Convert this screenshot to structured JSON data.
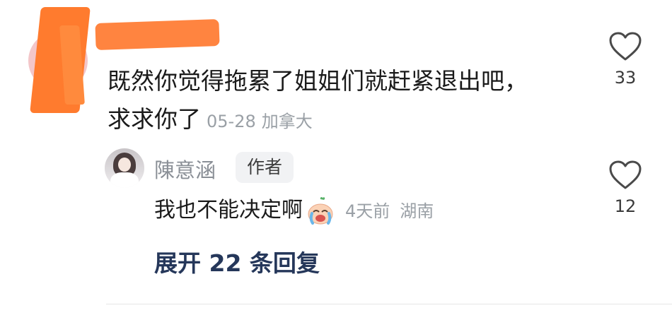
{
  "comment": {
    "text": "既然你觉得拖累了姐姐们就赶紧退出吧，求求你了",
    "date": "05-28",
    "location": "加拿大",
    "likes": "33"
  },
  "reply": {
    "username": "陳意涵",
    "badge": "作者",
    "text": "我也不能决定啊",
    "emoji_icon": "crying-face-emoji",
    "time": "4天前",
    "location": "湖南",
    "likes": "12"
  },
  "expand_replies": "展开 22 条回复",
  "colors": {
    "redaction": "#ff7b2e",
    "meta": "#9aa0a6",
    "link": "#25375a",
    "badge_bg": "#f1f2f4"
  }
}
